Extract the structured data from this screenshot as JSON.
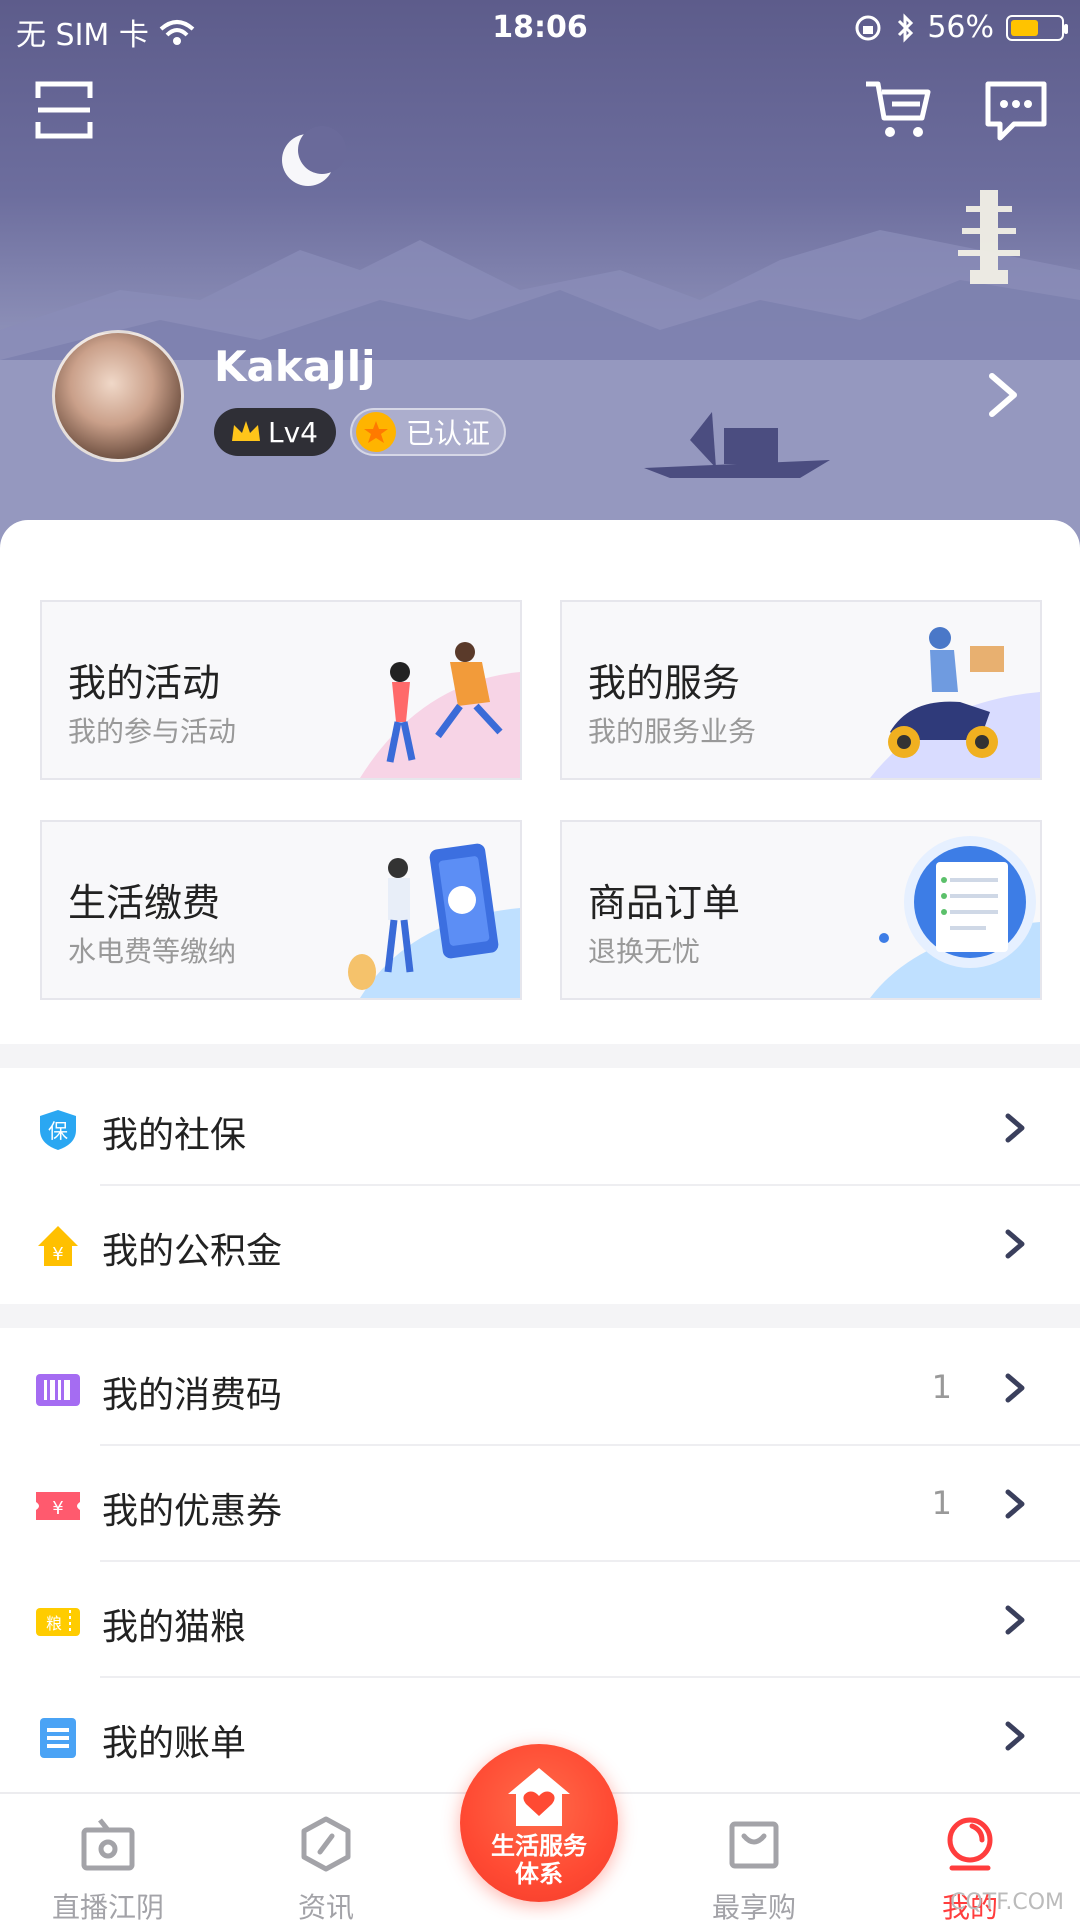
{
  "status_bar": {
    "carrier": "无 SIM 卡",
    "time": "18:06",
    "battery_percent": "56%",
    "battery_level": 0.56
  },
  "header": {
    "scan_icon": "scan-icon",
    "cart_icon": "cart-icon",
    "message_icon": "message-icon"
  },
  "profile": {
    "username": "KakaJlj",
    "level": "Lv4",
    "certified": "已认证"
  },
  "cards": [
    {
      "title": "我的活动",
      "subtitle": "我的参与活动",
      "accent": "#f7d4e6"
    },
    {
      "title": "我的服务",
      "subtitle": "我的服务业务",
      "accent": "#d9dcff"
    },
    {
      "title": "生活缴费",
      "subtitle": "水电费等缴纳",
      "accent": "#bfe0ff"
    },
    {
      "title": "商品订单",
      "subtitle": "退换无忧",
      "accent": "#bfe0ff"
    }
  ],
  "list_group1": [
    {
      "label": "我的社保",
      "icon": "shield-icon",
      "count": ""
    },
    {
      "label": "我的公积金",
      "icon": "house-yen-icon",
      "count": ""
    }
  ],
  "list_group2": [
    {
      "label": "我的消费码",
      "icon": "barcode-icon",
      "count": "1"
    },
    {
      "label": "我的优惠券",
      "icon": "coupon-icon",
      "count": "1"
    },
    {
      "label": "我的猫粮",
      "icon": "grain-ticket-icon",
      "count": ""
    },
    {
      "label": "我的账单",
      "icon": "bill-icon",
      "count": ""
    }
  ],
  "icon_text": {
    "shield": "保",
    "yen": "¥",
    "grain": "粮"
  },
  "tabbar": {
    "items": [
      "直播江阴",
      "资讯",
      "最享购",
      "我的"
    ],
    "center_label_line1": "生活服务",
    "center_label_line2": "体系",
    "active_color": "#ff3d3d"
  },
  "watermark": "CQTF.COM"
}
